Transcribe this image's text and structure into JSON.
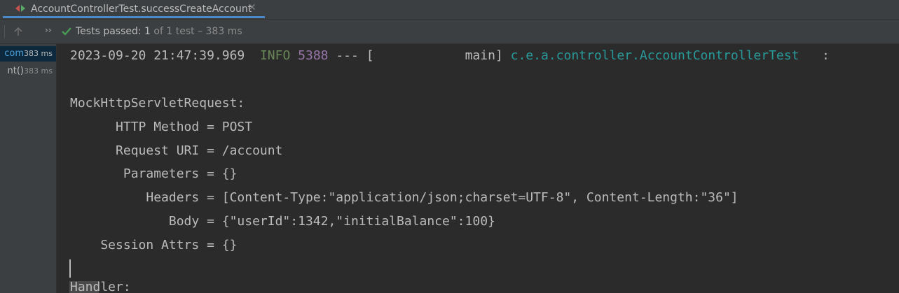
{
  "tab": {
    "title": "AccountControllerTest.successCreateAccount",
    "close": "✕",
    "icon": "test-run-icon"
  },
  "toolbar": {
    "up_icon": "arrow-up-icon",
    "expand": "››",
    "status_prefix": "Tests passed:",
    "passed_count": "1",
    "status_suffix": "of 1 test – 383 ms"
  },
  "tree": [
    {
      "name": "com",
      "time": "383 ms",
      "selected": true
    },
    {
      "name": "nt()",
      "time": "383 ms",
      "selected": false
    }
  ],
  "console": {
    "log": {
      "timestamp": "2023-09-20 21:47:39.969",
      "level": "INFO",
      "pid": "5388",
      "sep": "---",
      "thread": "[            main]",
      "logger": "c.e.a.controller.AccountControllerTest",
      "tail": ":"
    },
    "lines": [
      "MockHttpServletRequest:",
      "      HTTP Method = POST",
      "      Request URI = /account",
      "       Parameters = {}",
      "          Headers = [Content-Type:\"application/json;charset=UTF-8\", Content-Length:\"36\"]",
      "             Body = {\"userId\":1342,\"initialBalance\":100}",
      "    Session Attrs = {}"
    ],
    "partial": "Handler:"
  },
  "colors": {
    "info": "#6a8759",
    "pid": "#9876aa",
    "logger": "#299999",
    "check": "#499c54",
    "tab_accent": "#4a88c7"
  }
}
